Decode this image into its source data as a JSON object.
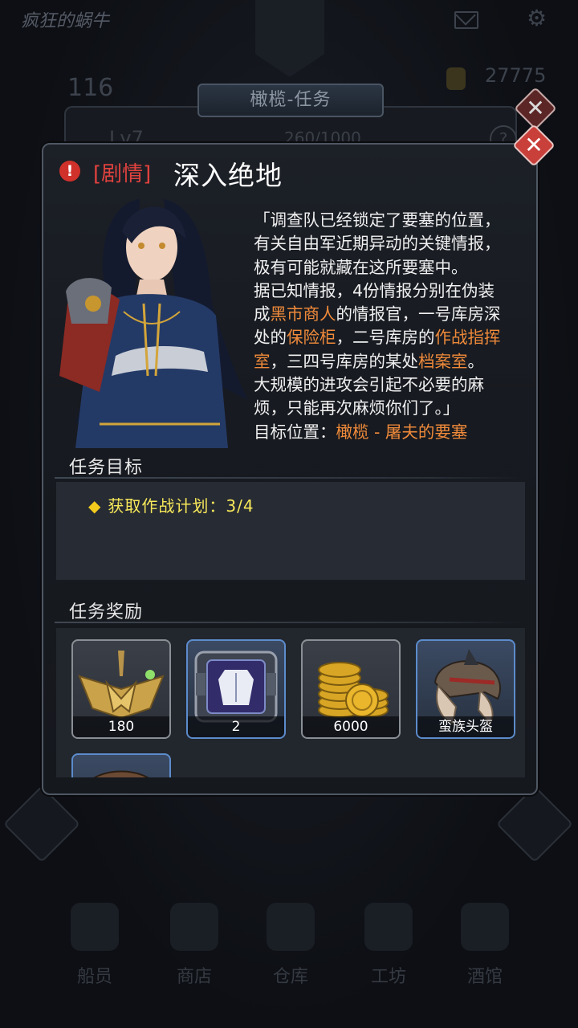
{
  "background": {
    "app_title": "疯狂的蜗牛",
    "power_value": "116",
    "gold_value": "27775",
    "level_text": "Lv7",
    "xp_text": "260/1000",
    "help_label": "?",
    "tab_title": "橄榄-任务",
    "nav": [
      {
        "label": "船员",
        "icon": "crew-icon"
      },
      {
        "label": "商店",
        "icon": "shop-icon"
      },
      {
        "label": "仓库",
        "icon": "warehouse-icon"
      },
      {
        "label": "工坊",
        "icon": "workshop-icon"
      },
      {
        "label": "酒馆",
        "icon": "tavern-icon"
      }
    ]
  },
  "dialog": {
    "close_glyph": "✕",
    "alert_glyph": "!",
    "tag": "[剧情]",
    "title": "深入绝地",
    "story": {
      "l1": "「调查队已经锁定了要塞的位置，",
      "l2": "有关自由军近期异动的关键情报，",
      "l3": "极有可能就藏在这所要塞中。",
      "l4": "据已知情报，4份情报分别在伪装",
      "l5a": "成",
      "l5b": "黑市商人",
      "l5c": "的情报官，一号库房深",
      "l6a": "处的",
      "l6b": "保险柜",
      "l6c": "，二号库房的",
      "l6d": "作战指挥",
      "l7a": "室",
      "l7b": "，三四号库房的某处",
      "l7c": "档案室",
      "l7d": "。",
      "l8": "大规模的进攻会引起不必要的麻",
      "l9": "烦，只能再次麻烦你们了。」",
      "l10a": "目标位置：",
      "l10b": "橄榄  -  屠夫的要塞"
    },
    "objectives_header": "任务目标",
    "objective": {
      "bullet": "◆",
      "text": "获取作战计划：3/4"
    },
    "rewards_header": "任务奖励",
    "rewards": [
      {
        "label": "180",
        "icon": "rank-xp-emblem-icon",
        "frame": "grey"
      },
      {
        "label": "2",
        "icon": "armor-crate-icon",
        "frame": "blue"
      },
      {
        "label": "6000",
        "icon": "gold-coins-icon",
        "frame": "grey"
      },
      {
        "label": "蛮族头盔",
        "icon": "barbarian-helmet-icon",
        "frame": "blue"
      }
    ],
    "accent_colors": {
      "tag": "#e0423e",
      "highlight": "#ef8a3a",
      "objective": "#f7e85a",
      "close": "#c9403b"
    }
  }
}
